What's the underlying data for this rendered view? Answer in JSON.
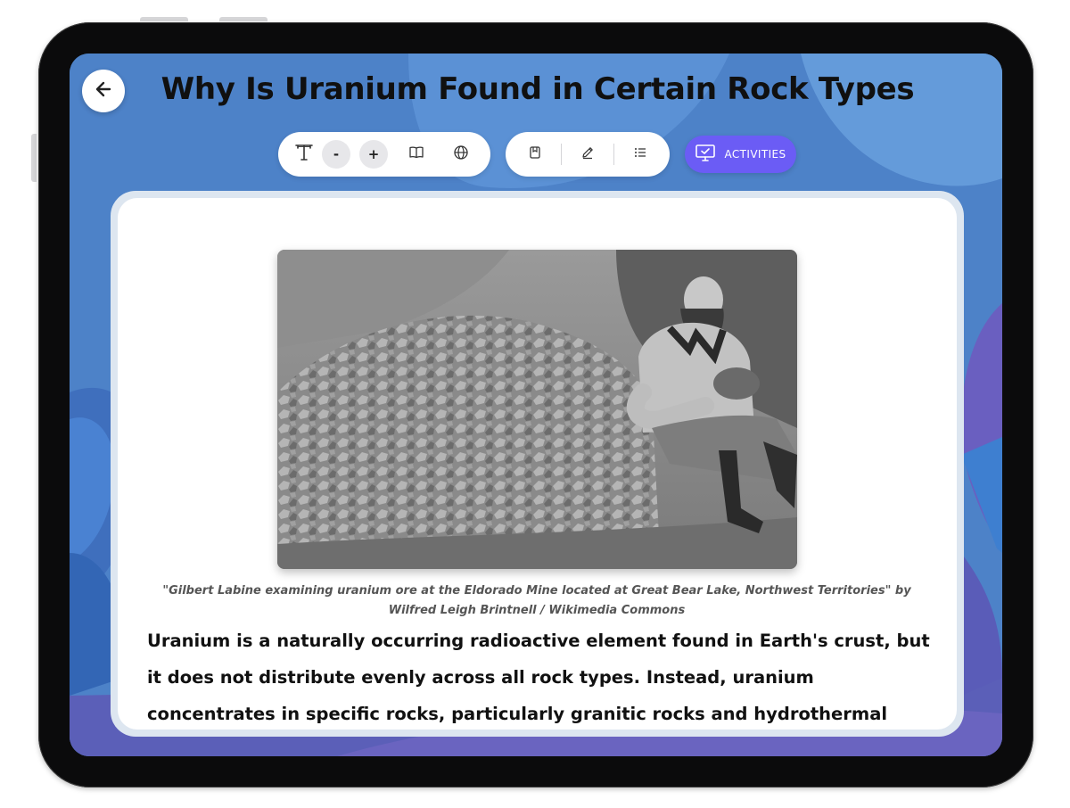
{
  "article": {
    "title": "Why Is Uranium Found in Certain Rock Types",
    "image_alt": "Man sitting beside a pile of uranium ore rocks",
    "caption_line1": "\"Gilbert Labine examining uranium ore at the Eldorado Mine located at Great Bear Lake, Northwest Territories\" by",
    "caption_line2": "Wilfred Leigh Brintnell / Wikimedia Commons",
    "paragraph": "Uranium is a naturally occurring radioactive element found in Earth's crust, but it does not distribute evenly across all rock types. Instead, uranium concentrates in specific rocks, particularly granitic rocks and hydrothermal deposits."
  },
  "toolbar": {
    "decrease_label": "-",
    "increase_label": "+",
    "activities_label": "ACTIVITIES"
  },
  "icons": {
    "back": "arrow-left-icon",
    "text_size": "text-size-icon",
    "dictionary": "open-book-icon",
    "translate": "globe-icon",
    "bookmark": "bookmark-icon",
    "annotate": "pencil-icon",
    "outline": "list-icon",
    "activities": "monitor-check-icon"
  },
  "colors": {
    "background": "#4d82c8",
    "accent": "#6b5cf5",
    "card": "#ffffff"
  }
}
